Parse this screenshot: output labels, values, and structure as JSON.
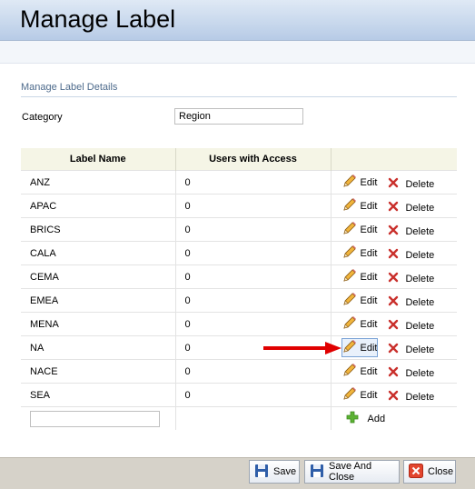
{
  "header": {
    "title": "Manage Label"
  },
  "section": {
    "title": "Manage Label Details"
  },
  "category": {
    "label": "Category",
    "value": "Region"
  },
  "table": {
    "columns": [
      "Label Name",
      "Users with Access",
      ""
    ],
    "rows": [
      {
        "name": "ANZ",
        "users": "0"
      },
      {
        "name": "APAC",
        "users": "0"
      },
      {
        "name": "BRICS",
        "users": "0"
      },
      {
        "name": "CALA",
        "users": "0"
      },
      {
        "name": "CEMA",
        "users": "0"
      },
      {
        "name": "EMEA",
        "users": "0"
      },
      {
        "name": "MENA",
        "users": "0"
      },
      {
        "name": "NA",
        "users": "0"
      },
      {
        "name": "NACE",
        "users": "0"
      },
      {
        "name": "SEA",
        "users": "0"
      }
    ],
    "edit_label": "Edit",
    "delete_label": "Delete",
    "add_label": "Add",
    "new_label_value": ""
  },
  "footer": {
    "save_label": "Save",
    "save_close_label": "Save And Close",
    "close_label": "Close"
  },
  "colors": {
    "header_gradient": [
      "#dfe9f5",
      "#b7cbe6"
    ],
    "table_header_bg": "#f5f5e6",
    "section_title": "#4e6b8c",
    "arrow": "#e00000",
    "footer_bg": "#d6d2c9"
  },
  "icons": [
    "pencil-icon",
    "delete-x-icon",
    "add-plus-icon",
    "save-disk-icon",
    "close-x-icon",
    "red-arrow"
  ]
}
